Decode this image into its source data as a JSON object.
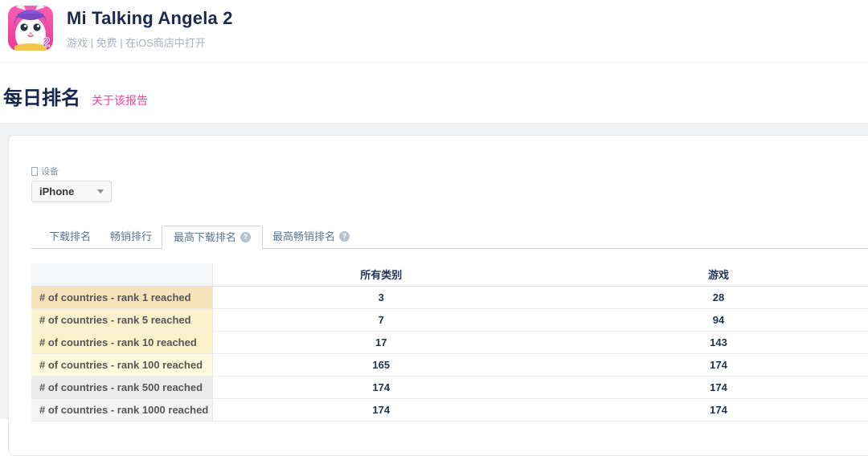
{
  "app": {
    "title": "Mi Talking Angela 2",
    "subtitle": "游戏 | 免费 | 在iOS商店中打开",
    "icon_badge": "2"
  },
  "section": {
    "title": "每日排名",
    "about_link": "关于该报告"
  },
  "filters": {
    "device_label": "设备",
    "device_value": "iPhone"
  },
  "tabs": [
    {
      "label": "下载排名"
    },
    {
      "label": "畅销排行"
    },
    {
      "label": "最高下载排名",
      "help": "?"
    },
    {
      "label": "最高畅销排名",
      "help": "?"
    }
  ],
  "table": {
    "columns": {
      "all_categories": "所有类别",
      "games": "游戏"
    },
    "rows": [
      {
        "label": "# of countries - rank 1 reached",
        "all_categories": "3",
        "games": "28",
        "bg": "#f6e2b8"
      },
      {
        "label": "# of countries - rank 5 reached",
        "all_categories": "7",
        "games": "94",
        "bg": "#fbf1cd"
      },
      {
        "label": "# of countries - rank 10 reached",
        "all_categories": "17",
        "games": "143",
        "bg": "#faf0ca"
      },
      {
        "label": "# of countries - rank 100 reached",
        "all_categories": "165",
        "games": "174",
        "bg": "#fcfadd"
      },
      {
        "label": "# of countries - rank 500 reached",
        "all_categories": "174",
        "games": "174",
        "bg": "#ebebec"
      },
      {
        "label": "# of countries - rank 1000 reached",
        "all_categories": "174",
        "games": "174",
        "bg": "#f5f5f6"
      }
    ]
  },
  "colors": {
    "accent_pink": "#ff3d9a",
    "navy_title": "#1b2a4e",
    "tab_text": "#5b7695",
    "page_gray": "#f0f1f3"
  }
}
